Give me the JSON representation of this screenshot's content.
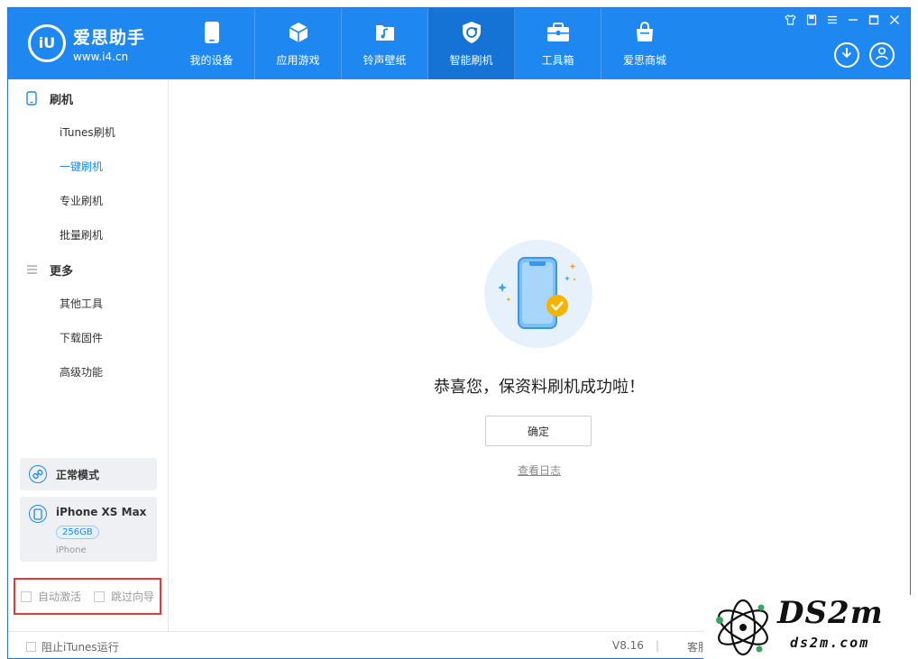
{
  "app": {
    "brand_name": "爱思助手",
    "brand_url": "www.i4.cn",
    "logo_text": "iU"
  },
  "nav": [
    {
      "label": "我的设备",
      "icon": "phone-icon"
    },
    {
      "label": "应用游戏",
      "icon": "cube-icon"
    },
    {
      "label": "铃声壁纸",
      "icon": "music-folder-icon"
    },
    {
      "label": "智能刷机",
      "icon": "refresh-shield-icon",
      "active": true
    },
    {
      "label": "工具箱",
      "icon": "toolbox-icon"
    },
    {
      "label": "爱思商城",
      "icon": "shopping-bag-icon"
    }
  ],
  "window_controls": [
    "shirt-icon",
    "note-icon",
    "menu-icon",
    "minimize-icon",
    "maximize-icon",
    "close-icon"
  ],
  "sidebar": {
    "flash_section": "刷机",
    "flash_items": [
      "iTunes刷机",
      "一键刷机",
      "专业刷机",
      "批量刷机"
    ],
    "active_item": "一键刷机",
    "more_section": "更多",
    "more_items": [
      "其他工具",
      "下载固件",
      "高级功能"
    ],
    "mode": "正常模式",
    "device": {
      "name": "iPhone XS Max",
      "capacity": "256GB",
      "type": "iPhone"
    },
    "options": {
      "auto_activate": "自动激活",
      "skip_guide": "跳过向导"
    }
  },
  "main": {
    "message": "恭喜您，保资料刷机成功啦！",
    "confirm_label": "确定",
    "log_link": "查看日志"
  },
  "statusbar": {
    "block_itunes": "阻止iTunes运行",
    "version": "V8.16",
    "separator": "|",
    "service": "客服"
  },
  "watermark": {
    "title": "DS2m",
    "subtitle": "ds2m.com"
  },
  "colors": {
    "primary": "#1e88f0",
    "nav_active": "#1673d6",
    "highlight_border": "#e53935",
    "success": "#f5b400"
  }
}
